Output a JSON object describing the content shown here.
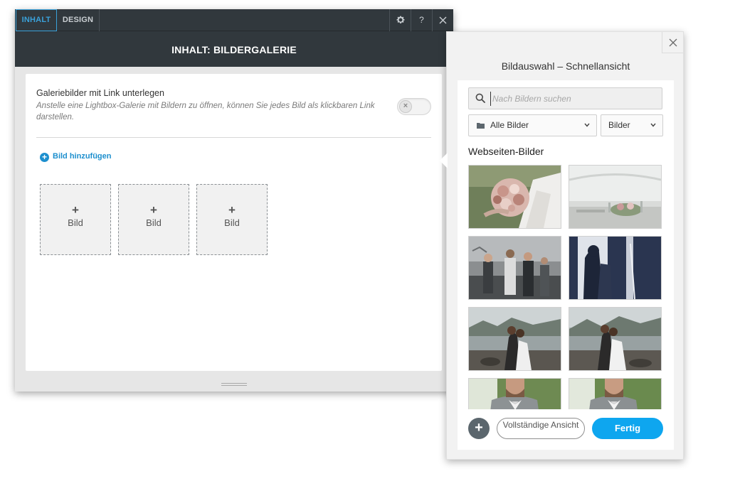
{
  "editor": {
    "tabs": [
      {
        "label": "INHALT",
        "active": true
      },
      {
        "label": "DESIGN",
        "active": false
      }
    ],
    "toolbar_icons": [
      "gear-icon",
      "help-icon",
      "close-icon"
    ],
    "help_glyph": "?",
    "title": "INHALT: BILDERGALERIE",
    "setting": {
      "label": "Galeriebilder mit Link unterlegen",
      "description": "Anstelle eine Lightbox-Galerie mit Bildern zu öffnen, können Sie jedes Bild als klickbaren Link darstellen.",
      "enabled": false
    },
    "add_image_label": "Bild hinzufügen",
    "slots": [
      {
        "plus": "+",
        "label": "Bild"
      },
      {
        "plus": "+",
        "label": "Bild"
      },
      {
        "plus": "+",
        "label": "Bild"
      }
    ],
    "accent_color": "#1d8fce"
  },
  "picker": {
    "title": "Bildauswahl – Schnellansicht",
    "search_placeholder": "Nach Bildern suchen",
    "folder_select": "Alle Bilder",
    "type_select": "Bilder",
    "section_label": "Webseiten-Bilder",
    "thumbnails": [
      "bridal-bouquet",
      "wedding-tent-table",
      "wedding-party-dance",
      "couple-silhouette-window",
      "couple-kiss-lakeshore",
      "couple-kiss-lakeshore-alt",
      "groom-portrait",
      "groom-portrait-alt"
    ],
    "add_button": "+",
    "full_view_button": "Vollständige Ansicht",
    "done_button": "Fertig",
    "done_color": "#0ea6ef"
  }
}
